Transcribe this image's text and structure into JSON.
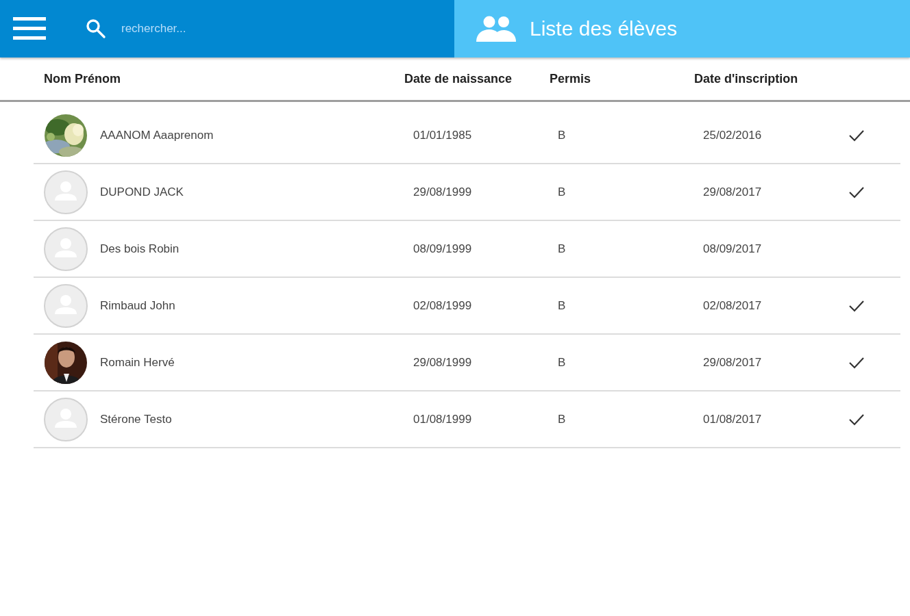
{
  "search": {
    "placeholder": "rechercher..."
  },
  "title": "Liste des élèves",
  "table": {
    "columns": [
      "Nom Prénom",
      "Date de naissance",
      "Permis",
      "Date d'inscription"
    ],
    "rows": [
      {
        "name": "AAANOM Aaaprenom",
        "birth_date": "01/01/1985",
        "permis": "B",
        "registration_date": "25/02/2016",
        "checked": true
      },
      {
        "kind": "placeholder",
        "name": "DUPOND JACK",
        "birth_date": "29/08/1999",
        "permis": "B",
        "registration_date": "29/08/2017",
        "checked": true
      },
      {
        "kind": "placeholder",
        "name": "Des bois Robin",
        "birth_date": "08/09/1999",
        "permis": "B",
        "registration_date": "08/09/2017",
        "checked": false
      },
      {
        "kind": "placeholder",
        "name": "Rimbaud John",
        "birth_date": "02/08/1999",
        "permis": "B",
        "registration_date": "02/08/2017",
        "checked": true
      },
      {
        "kind": "portrait",
        "name": "Romain Hervé",
        "birth_date": "29/08/1999",
        "permis": "B",
        "registration_date": "29/08/2017",
        "checked": true
      },
      {
        "kind": "placeholder",
        "name": "Stérone Testo",
        "birth_date": "01/08/1999",
        "permis": "B",
        "registration_date": "01/08/2017",
        "checked": true
      }
    ]
  }
}
